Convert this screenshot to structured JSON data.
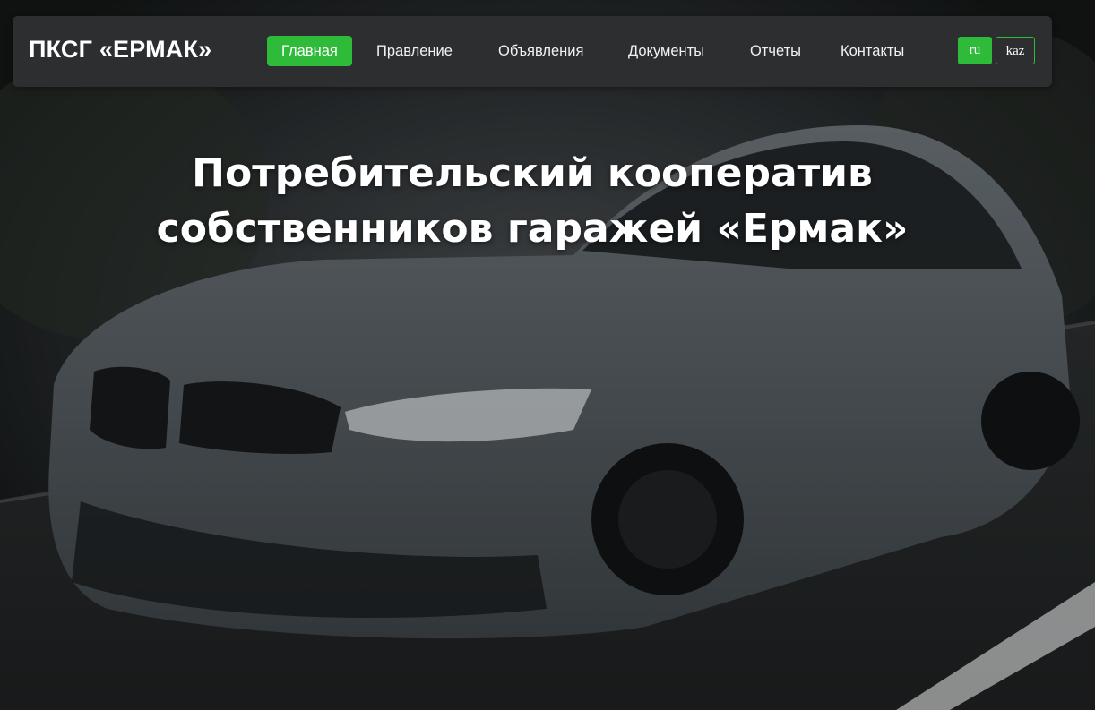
{
  "header": {
    "brand": "ПКСГ «ЕРМАК»",
    "nav": [
      {
        "label": "Главная",
        "active": true
      },
      {
        "label": "Правление",
        "active": false
      },
      {
        "label": "Объявления",
        "active": false
      },
      {
        "label": "Документы",
        "active": false
      },
      {
        "label": "Отчеты",
        "active": false
      },
      {
        "label": "Контакты",
        "active": false
      }
    ],
    "languages": [
      {
        "label": "ru",
        "active": true
      },
      {
        "label": "kaz",
        "active": false
      }
    ]
  },
  "hero": {
    "title_line1": "Потребительский кооператив",
    "title_line2": "собственников гаражей «Ермак»",
    "background": "car-photo"
  },
  "colors": {
    "accent": "#2fbb3a",
    "navbar_bg": "#2c2e2f",
    "text": "#ffffff"
  }
}
